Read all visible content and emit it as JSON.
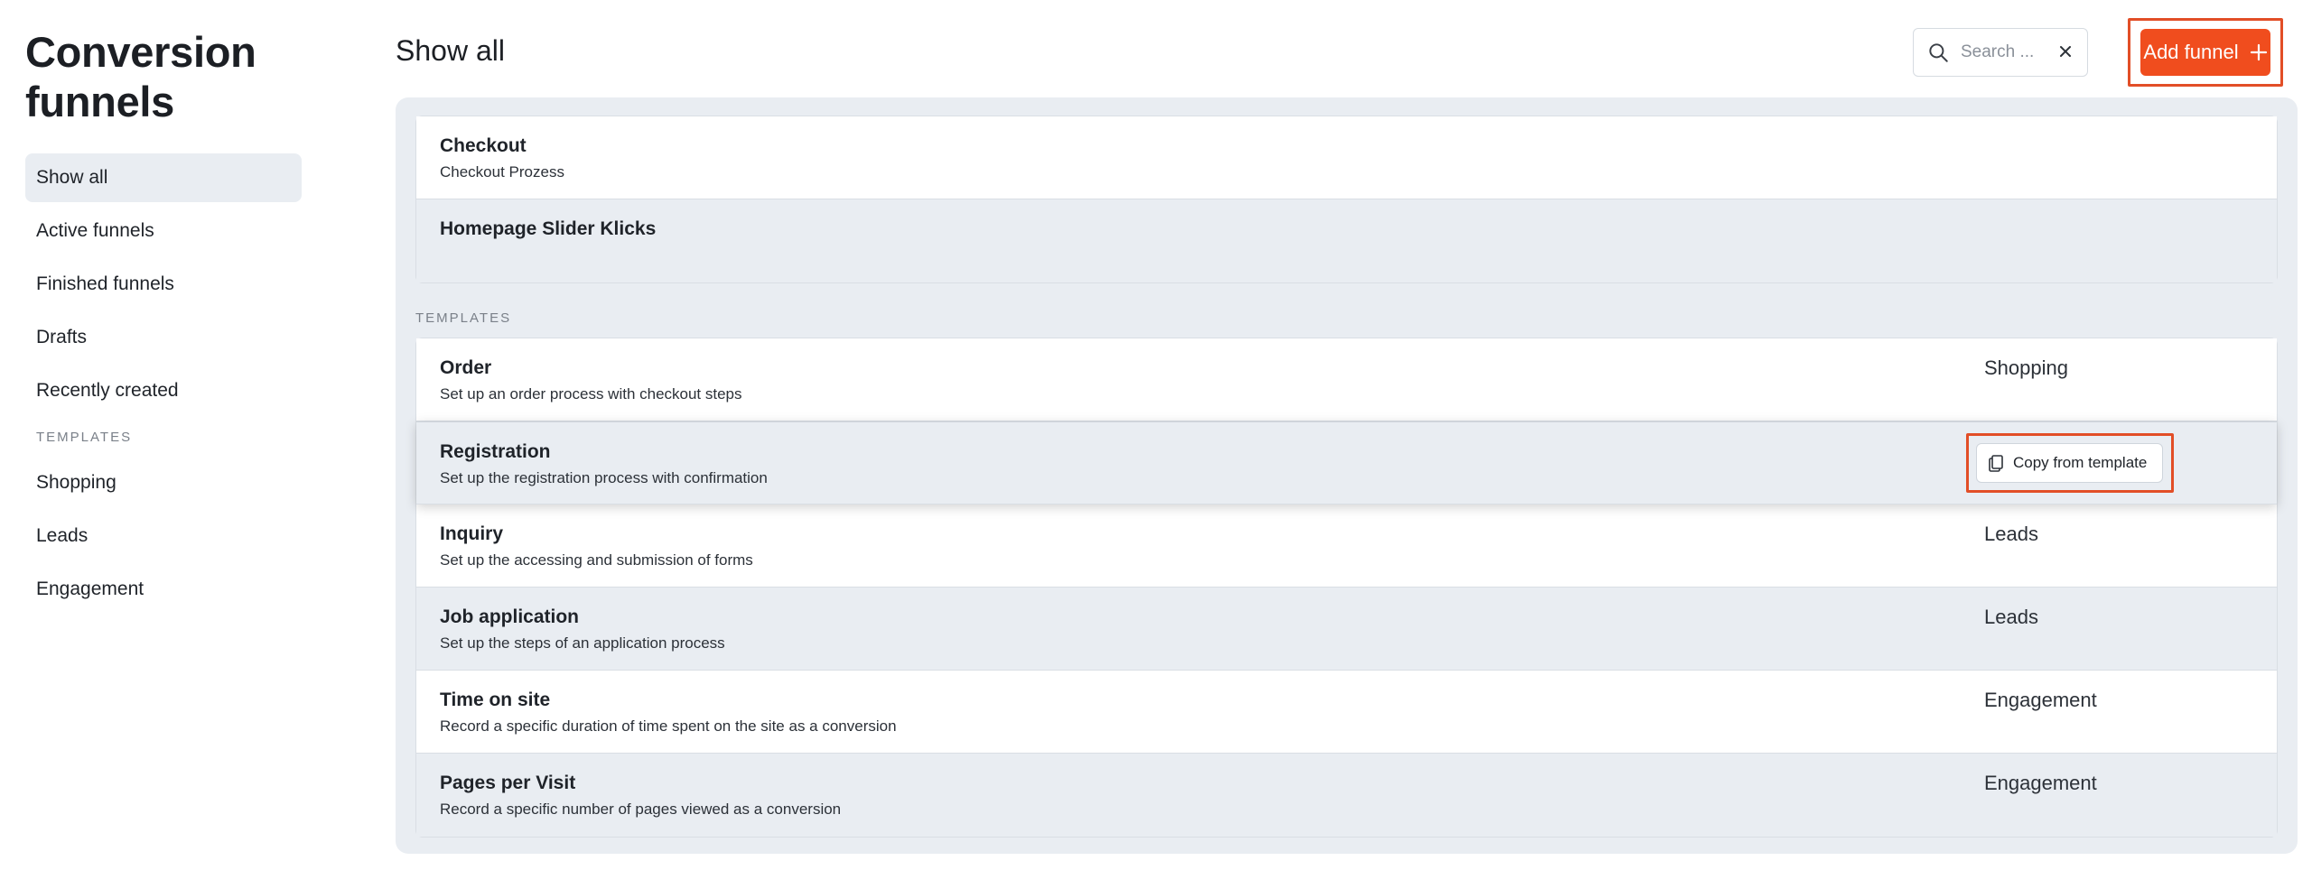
{
  "sidebar": {
    "title": "Conversion funnels",
    "nav": [
      {
        "label": "Show all",
        "active": true
      },
      {
        "label": "Active funnels",
        "active": false
      },
      {
        "label": "Finished funnels",
        "active": false
      },
      {
        "label": "Drafts",
        "active": false
      },
      {
        "label": "Recently created",
        "active": false
      }
    ],
    "templates_heading": "TEMPLATES",
    "templates": [
      {
        "label": "Shopping"
      },
      {
        "label": "Leads"
      },
      {
        "label": "Engagement"
      }
    ]
  },
  "header": {
    "title": "Show all",
    "search_placeholder": "Search ...",
    "add_label": "Add funnel"
  },
  "funnels": [
    {
      "title": "Checkout",
      "desc": "Checkout Prozess"
    },
    {
      "title": "Homepage Slider Klicks",
      "desc": ""
    }
  ],
  "templates_heading": "TEMPLATES",
  "templates": [
    {
      "title": "Order",
      "desc": "Set up an order process with checkout steps",
      "category": "Shopping"
    },
    {
      "title": "Registration",
      "desc": "Set up the registration process with confirmation",
      "category": "",
      "action": "Copy from template"
    },
    {
      "title": "Inquiry",
      "desc": "Set up the accessing and submission of forms",
      "category": "Leads"
    },
    {
      "title": "Job application",
      "desc": "Set up the steps of an application process",
      "category": "Leads"
    },
    {
      "title": "Time on site",
      "desc": "Record a specific duration of time spent on the site as a conversion",
      "category": "Engagement"
    },
    {
      "title": "Pages per Visit",
      "desc": "Record a specific number of pages viewed as a conversion",
      "category": "Engagement"
    }
  ],
  "colors": {
    "accent": "#f04d1e",
    "highlight_frame": "#e24e27",
    "panel_bg": "#e9edf2"
  }
}
